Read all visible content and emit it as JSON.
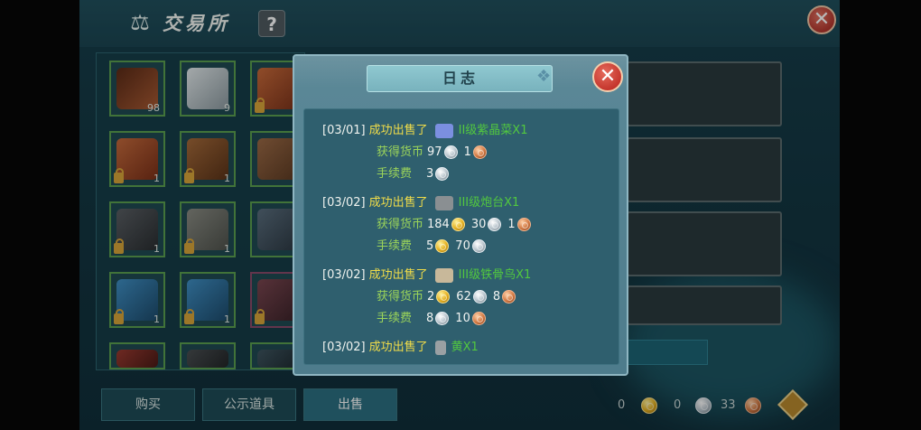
{
  "screen": {
    "title": "交易所",
    "title_icon": "scale-icon",
    "help_label": "?",
    "close_label": "✕"
  },
  "inventory": {
    "slots": [
      {
        "count": "98",
        "locked": false,
        "color": "#8a4a2c"
      },
      {
        "count": "9",
        "locked": false,
        "color": "#b8c4c8"
      },
      {
        "count": "",
        "locked": true,
        "color": "#b25a2e"
      },
      {
        "count": "1",
        "locked": true,
        "color": "#b3512c"
      },
      {
        "count": "1",
        "locked": true,
        "color": "#7b4a2a"
      },
      {
        "count": "",
        "locked": false,
        "color": "#8a5a3a"
      },
      {
        "count": "1",
        "locked": true,
        "color": "#454a4e"
      },
      {
        "count": "1",
        "locked": true,
        "color": "#6b6d66"
      },
      {
        "count": "",
        "locked": false,
        "color": "#4a5a66"
      },
      {
        "count": "1",
        "locked": true,
        "color": "#2f6f9a"
      },
      {
        "count": "1",
        "locked": true,
        "color": "#2f6f9a"
      },
      {
        "count": "",
        "locked": true,
        "color": "#6a3a46"
      }
    ]
  },
  "bottom_tabs": {
    "buy": "购买",
    "showcase": "公示道具",
    "sell": "出售"
  },
  "wallet": {
    "gold": "0",
    "silver": "0",
    "copper": "33"
  },
  "log_dialog": {
    "title": "日志",
    "close_label": "✕",
    "entries": [
      {
        "date": "[03/01]",
        "action": "成功出售了",
        "item": "II级紫晶菜X1",
        "item_color": "#7b8fe0",
        "earned_label": "获得货币",
        "earned_gold": "",
        "earned_silver": "97",
        "earned_copper": "1",
        "fee_label": "手续费",
        "fee_gold": "",
        "fee_silver": "3",
        "fee_copper": ""
      },
      {
        "date": "[03/02]",
        "action": "成功出售了",
        "item": "III级炮台X1",
        "item_color": "#8a8f92",
        "earned_label": "获得货币",
        "earned_gold": "184",
        "earned_silver": "30",
        "earned_copper": "1",
        "fee_label": "手续费",
        "fee_gold": "5",
        "fee_silver": "70",
        "fee_copper": ""
      },
      {
        "date": "[03/02]",
        "action": "成功出售了",
        "item": "III级铁骨鸟X1",
        "item_color": "#c8b89a",
        "earned_label": "获得货币",
        "earned_gold": "2",
        "earned_silver": "62",
        "earned_copper": "8",
        "fee_label": "手续费",
        "fee_gold": "",
        "fee_silver": "8",
        "fee_copper": "10"
      },
      {
        "date": "[03/02]",
        "action": "成功出售了",
        "item": "黄X1",
        "item_color": "#9aa0a3"
      }
    ]
  }
}
